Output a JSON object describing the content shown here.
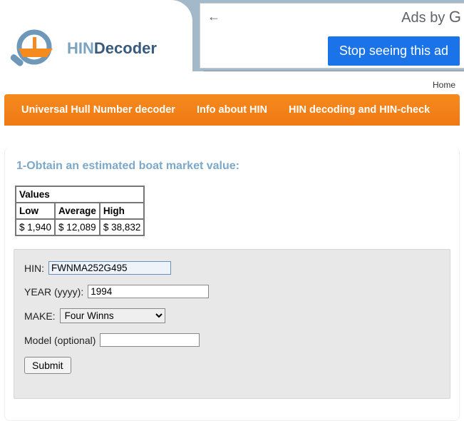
{
  "logo": {
    "part1": "HIN",
    "part2": "Decoder"
  },
  "ad": {
    "back_glyph": "←",
    "ads_by": "Ads by ",
    "g": "G",
    "stop_label": "Stop seeing this ad"
  },
  "breadcrumb": {
    "home": "Home"
  },
  "nav": {
    "item1": "Universal Hull Number decoder",
    "item2": "Info about HIN",
    "item3": "HIN decoding and HIN-check"
  },
  "section": {
    "title": "1-Obtain an estimated boat market value:"
  },
  "values_table": {
    "caption": "Values",
    "headers": {
      "low": "Low",
      "avg": "Average",
      "high": "High"
    },
    "row": {
      "low": "$ 1,940",
      "avg": "$ 12,089",
      "high": "$ 38,832"
    }
  },
  "form": {
    "hin_label": "HIN:",
    "hin_value": "FWNMA252G495",
    "year_label": "YEAR (yyyy):",
    "year_value": "1994",
    "make_label": "MAKE:",
    "make_value": "Four Winns",
    "model_label": "Model (optional)",
    "model_value": "",
    "submit_label": "Submit"
  }
}
